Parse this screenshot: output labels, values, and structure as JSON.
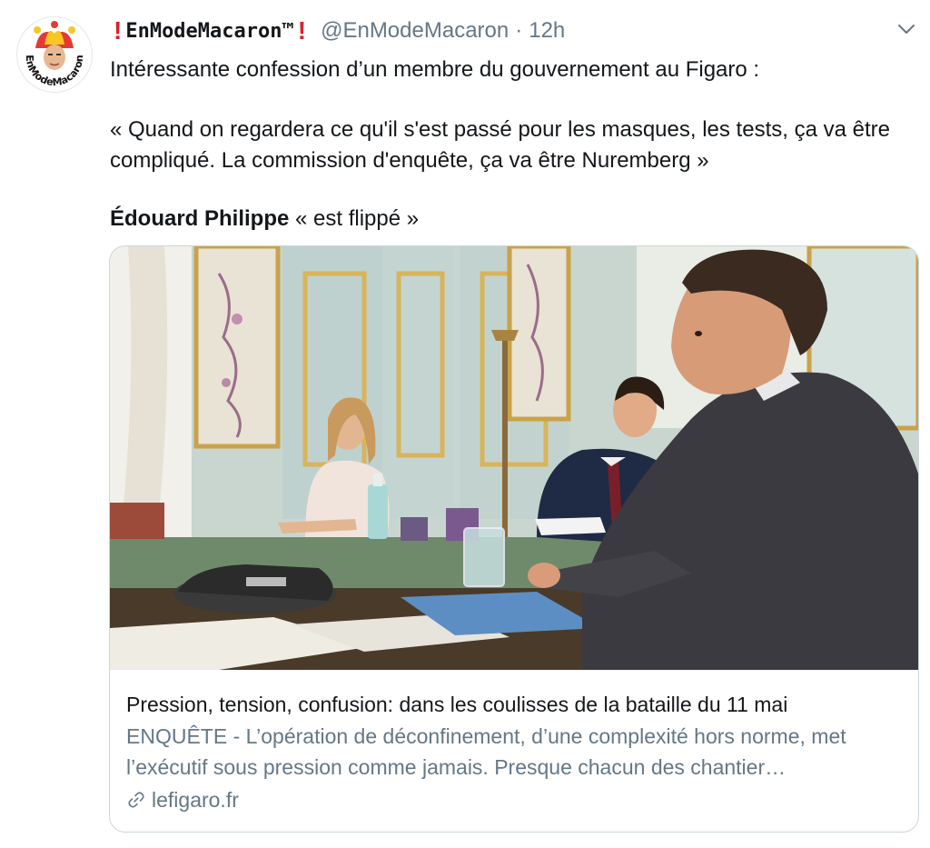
{
  "tweet": {
    "avatar_text": "EnModeMacaron",
    "display_name": "EnModeMacaron™",
    "handle": "@EnModeMacaron",
    "separator": "·",
    "time": "12h",
    "text_line1": "Intéressante confession d’un membre du gouvernement au Figaro :",
    "text_quote": "« Quand on regardera ce qu'il s'est passé pour les masques, les tests, ça va être compliqué. La commission d'enquête, ça va être Nuremberg »",
    "text_name": "Édouard Philippe",
    "text_after_name": " « est flippé »"
  },
  "card": {
    "title": "Pression, tension, confusion: dans les coulisses de la bataille du 11 mai",
    "description": "ENQUÊTE - L’opération de déconfinement, d’une complexité hors norme, met l’exécutif sous pression comme jamais. Presque chacun des chantier…",
    "domain": "lefigaro.fr"
  },
  "icons": {
    "exclamation": "heavy-exclamation-mark",
    "menu": "chevron-down-icon",
    "link": "link-icon"
  },
  "colors": {
    "exclamation": "#d9202f",
    "secondary_text": "#657786",
    "card_border": "#ccd6dd"
  }
}
